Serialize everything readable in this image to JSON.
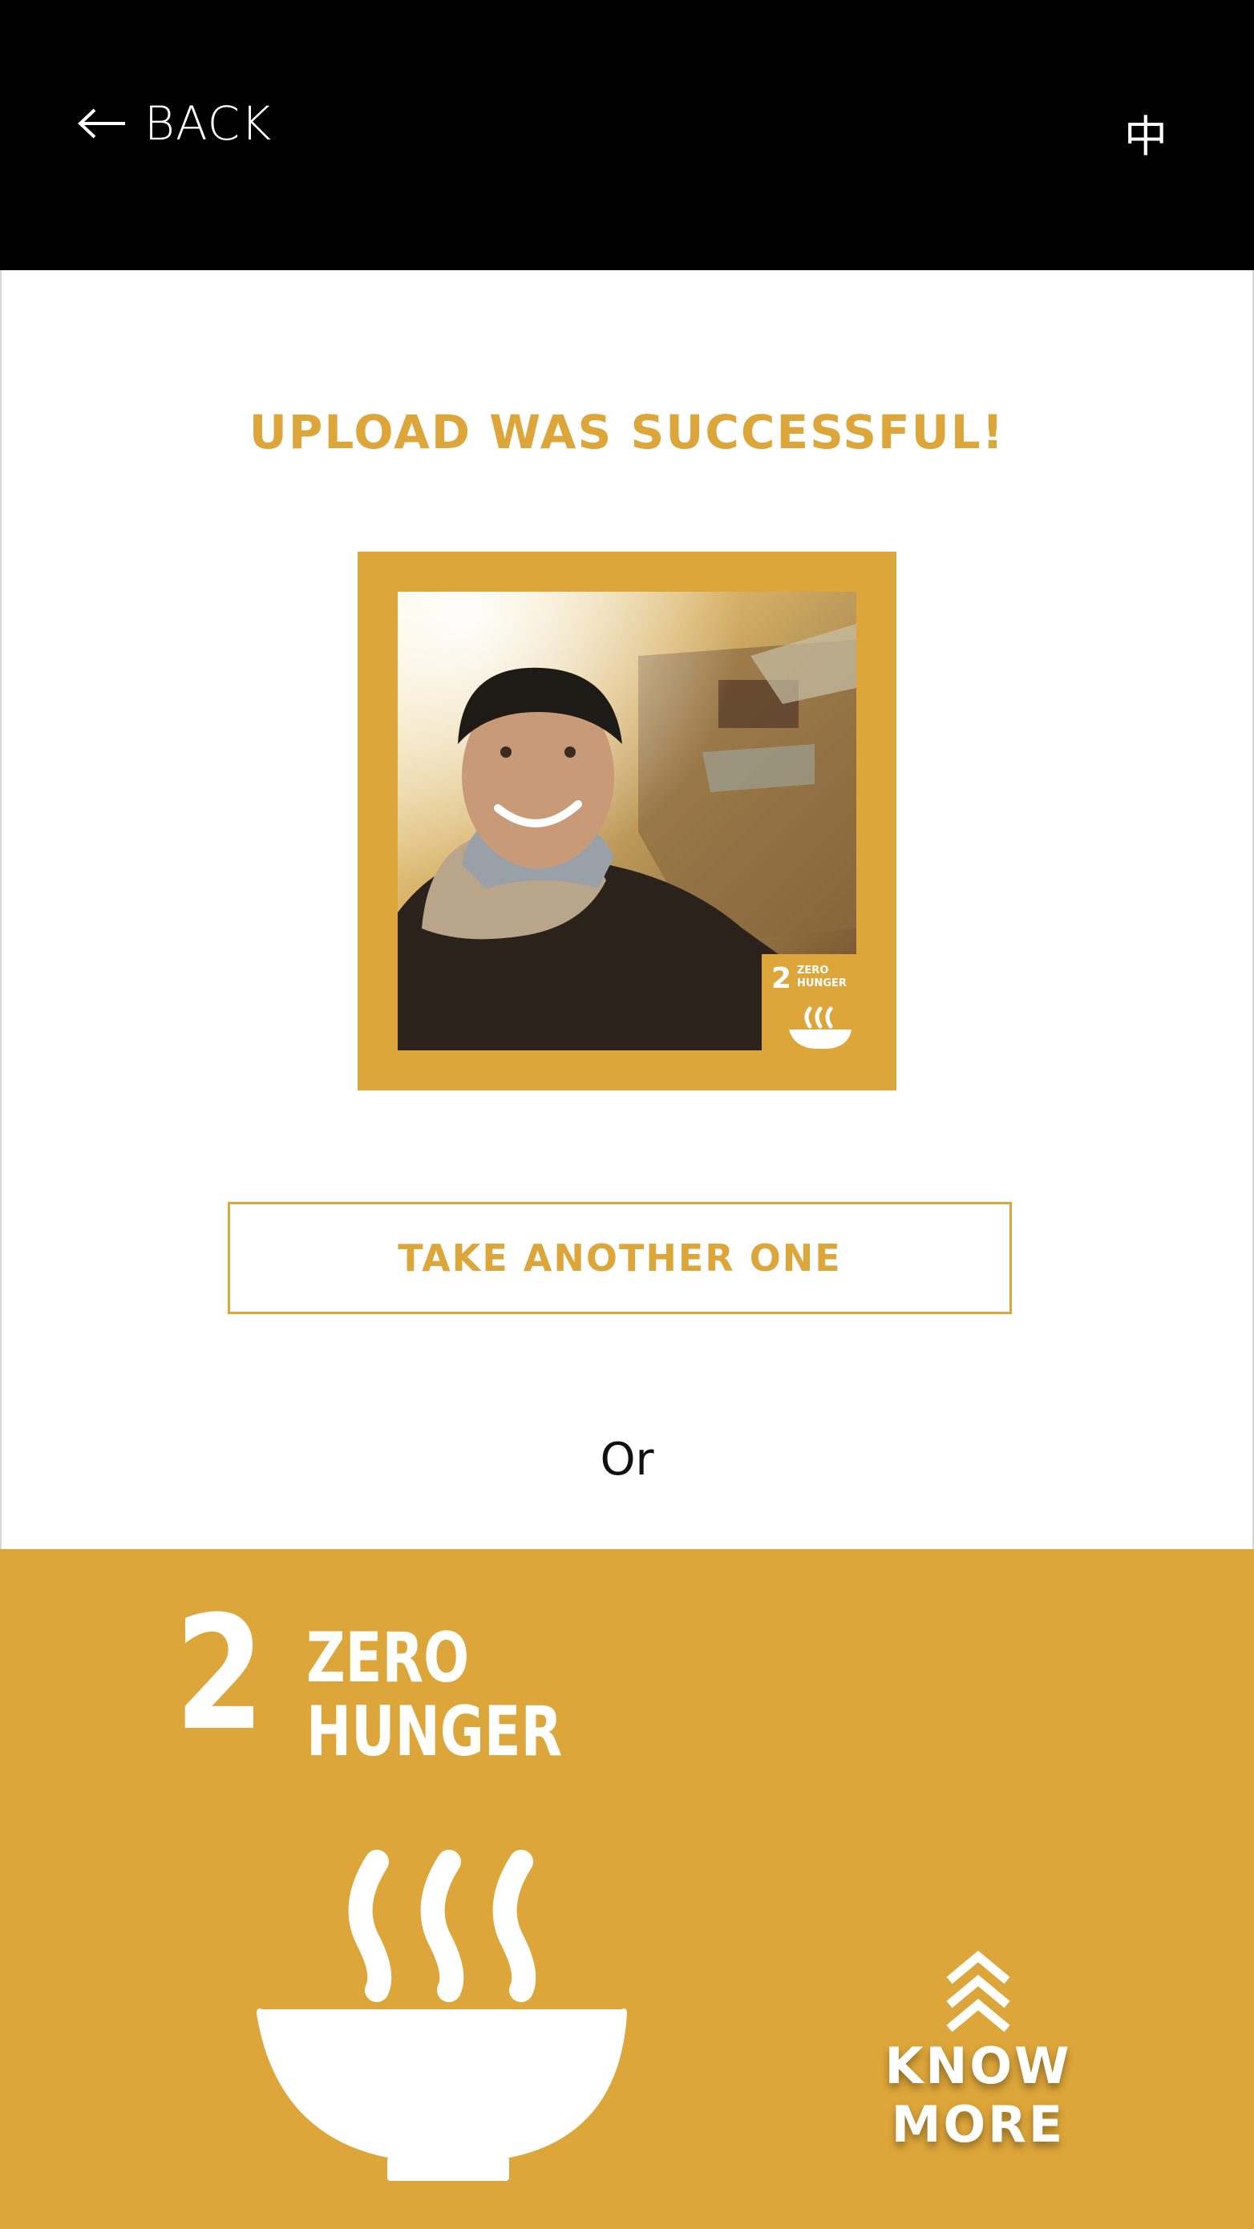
{
  "colors": {
    "accent": "#DDA63A",
    "header_bg": "#000000",
    "page_bg": "#FFFFFF"
  },
  "header": {
    "back_label": "BACK",
    "back_icon": "arrow-left-icon",
    "language_label": "中"
  },
  "main": {
    "status_title": "UPLOAD WAS SUCCESSFUL!",
    "photo_badge": {
      "number": "2",
      "line1": "ZERO",
      "line2": "HUNGER",
      "icon": "bowl-icon"
    },
    "take_another_label": "TAKE ANOTHER ONE",
    "or_label": "Or"
  },
  "goal": {
    "number": "2",
    "name_line1": "ZERO",
    "name_line2": "HUNGER",
    "icon": "bowl-icon",
    "know_more_label": "KNOW MORE",
    "know_more_icon": "double-chevron-up-icon"
  }
}
